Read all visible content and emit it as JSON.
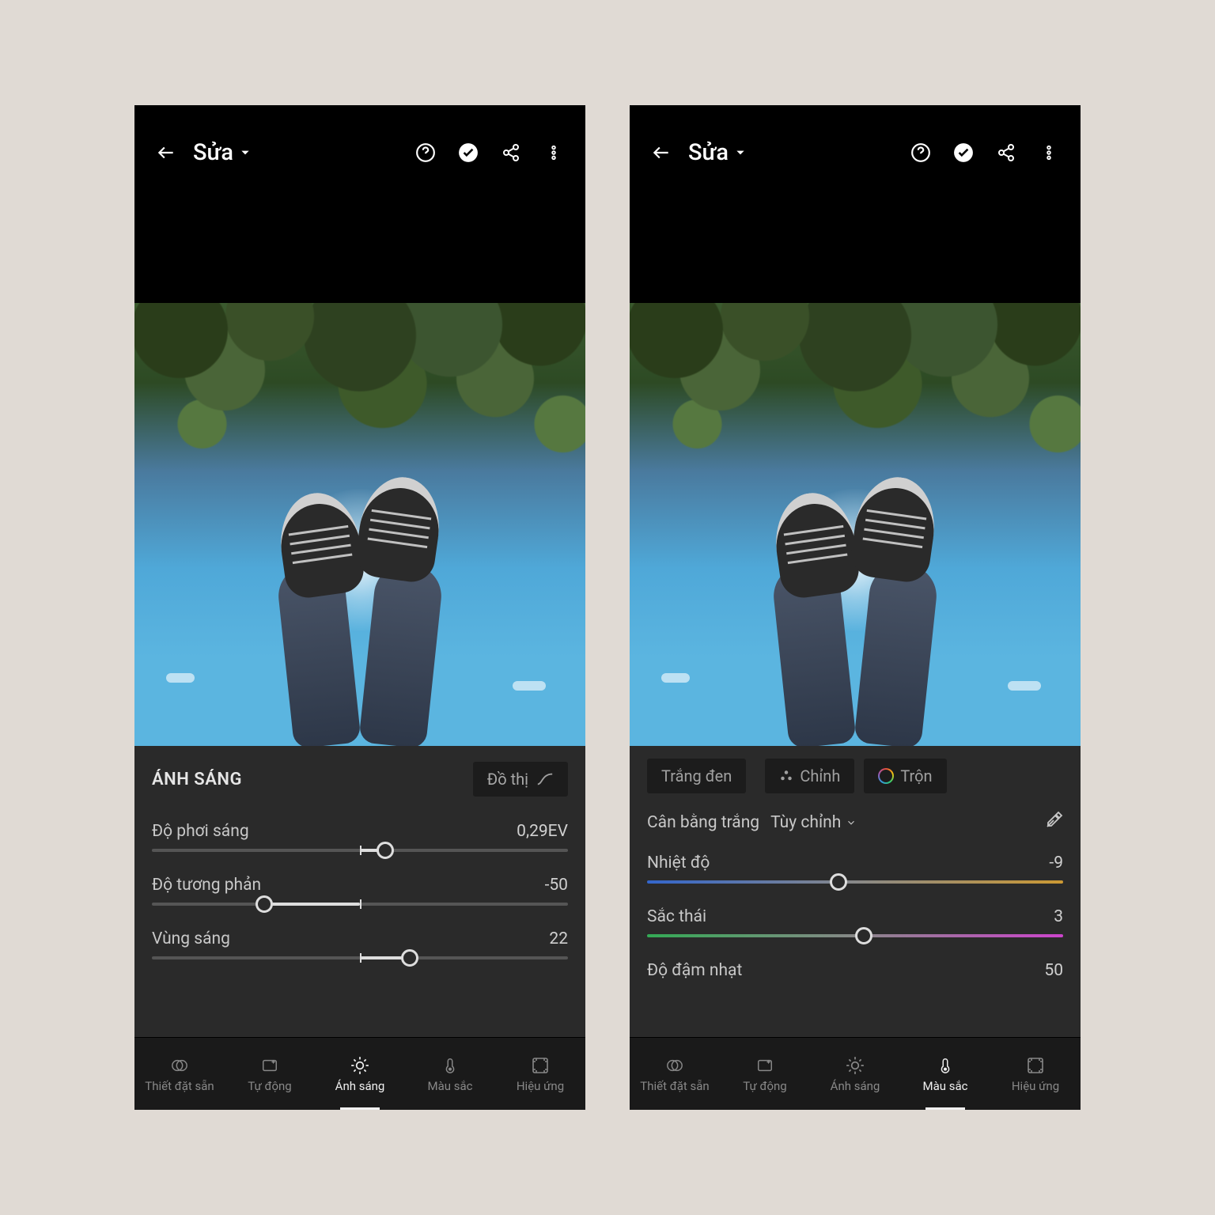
{
  "title": "Sửa",
  "left": {
    "panel_title": "ÁNH SÁNG",
    "graph_btn": "Đồ thị",
    "sliders": [
      {
        "label": "Độ phơi sáng",
        "value": "0,29EV",
        "pos": 56
      },
      {
        "label": "Độ tương phản",
        "value": "-50",
        "pos": 27
      },
      {
        "label": "Vùng sáng",
        "value": "22",
        "pos": 62
      }
    ],
    "nav": [
      {
        "label": "Thiết đặt sẵn",
        "icon": "preset"
      },
      {
        "label": "Tự động",
        "icon": "auto"
      },
      {
        "label": "Ánh sáng",
        "icon": "light",
        "active": true
      },
      {
        "label": "Màu sắc",
        "icon": "temp"
      },
      {
        "label": "Hiệu ứng",
        "icon": "fx"
      }
    ]
  },
  "right": {
    "bw_chip": "Trắng đen",
    "adjust_chip": "Chỉnh",
    "mix_chip": "Trộn",
    "wb_label": "Cân bằng trắng",
    "wb_value": "Tùy chỉnh",
    "sliders": [
      {
        "label": "Nhiệt độ",
        "value": "-9",
        "pos": 46,
        "grad": "temp"
      },
      {
        "label": "Sắc thái",
        "value": "3",
        "pos": 52,
        "grad": "tint"
      },
      {
        "label": "Độ đậm nhạt",
        "value": "50",
        "partial": true
      }
    ],
    "nav": [
      {
        "label": "Thiết đặt sẵn",
        "icon": "preset"
      },
      {
        "label": "Tự động",
        "icon": "auto"
      },
      {
        "label": "Ánh sáng",
        "icon": "light"
      },
      {
        "label": "Màu sắc",
        "icon": "temp",
        "active": true
      },
      {
        "label": "Hiệu ứng",
        "icon": "fx"
      }
    ]
  }
}
